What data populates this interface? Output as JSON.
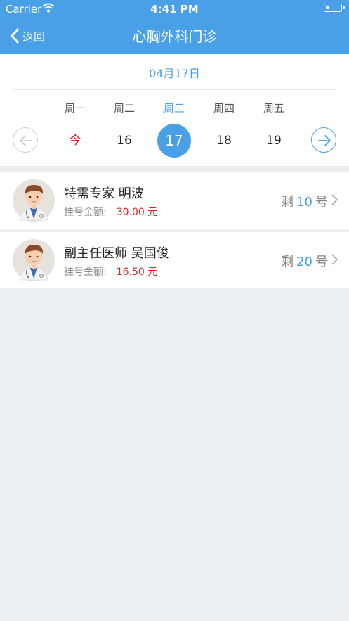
{
  "status_bar": {
    "carrier": "Carrier",
    "time": "4:41 PM"
  },
  "header": {
    "back_label": "返回",
    "title": "心胸外科门诊"
  },
  "date_picker": {
    "current_date": "04月17日",
    "weekdays": [
      "周一",
      "周二",
      "周三",
      "周四",
      "周五"
    ],
    "days": [
      "今",
      "16",
      "17",
      "18",
      "19"
    ],
    "selected_index": 2
  },
  "doctors": [
    {
      "name": "特需专家 明波",
      "fee_label": "挂号金额:",
      "fee": "30.00 元",
      "remain_prefix": "剩",
      "remain_count": "10",
      "remain_suffix": "号"
    },
    {
      "name": "副主任医师 吴国俊",
      "fee_label": "挂号金额:",
      "fee": "16.50 元",
      "remain_prefix": "剩",
      "remain_count": "20",
      "remain_suffix": "号"
    }
  ],
  "colors": {
    "accent": "#4aa0e6",
    "price": "#e02020",
    "background": "#eceff2"
  }
}
